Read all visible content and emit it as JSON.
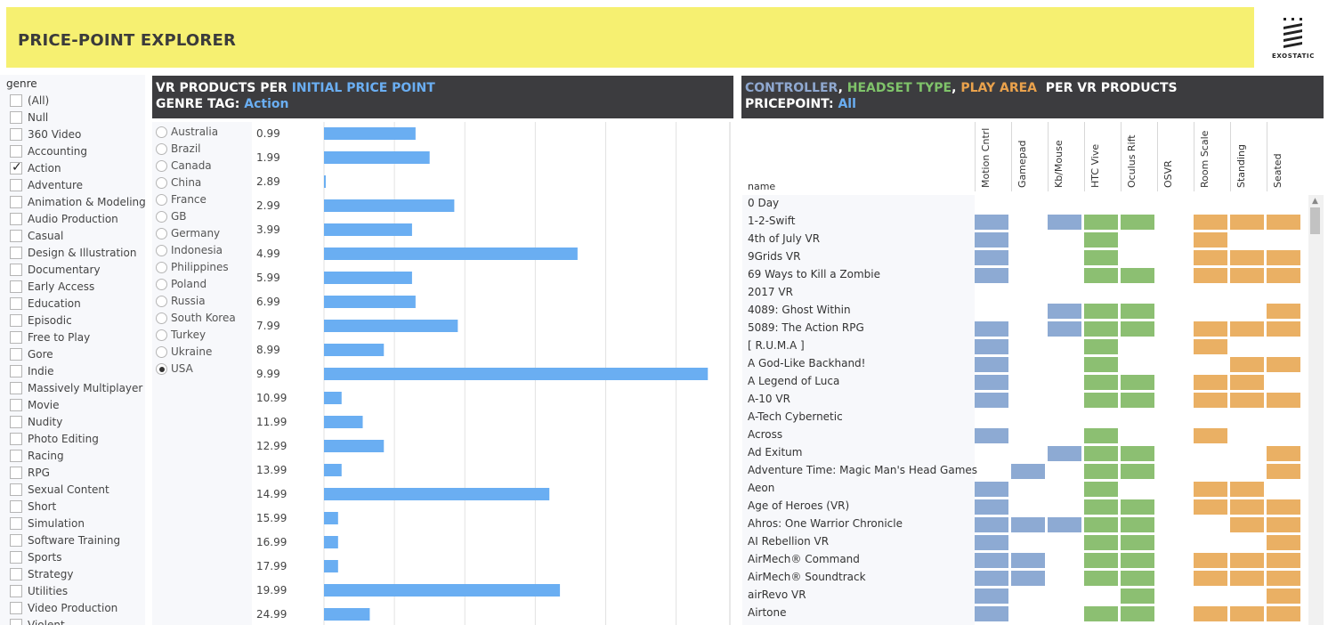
{
  "header": {
    "title": "PRICE-POINT EXPLORER",
    "logo_text": "EXOSTATIC"
  },
  "genre_filter": {
    "title": "genre",
    "items": [
      {
        "label": "(All)",
        "checked": false
      },
      {
        "label": "Null",
        "checked": false
      },
      {
        "label": "360 Video",
        "checked": false
      },
      {
        "label": "Accounting",
        "checked": false
      },
      {
        "label": "Action",
        "checked": true
      },
      {
        "label": "Adventure",
        "checked": false
      },
      {
        "label": "Animation & Modeling",
        "checked": false
      },
      {
        "label": "Audio Production",
        "checked": false
      },
      {
        "label": "Casual",
        "checked": false
      },
      {
        "label": "Design & Illustration",
        "checked": false
      },
      {
        "label": "Documentary",
        "checked": false
      },
      {
        "label": "Early Access",
        "checked": false
      },
      {
        "label": "Education",
        "checked": false
      },
      {
        "label": "Episodic",
        "checked": false
      },
      {
        "label": "Free to Play",
        "checked": false
      },
      {
        "label": "Gore",
        "checked": false
      },
      {
        "label": "Indie",
        "checked": false
      },
      {
        "label": "Massively Multiplayer",
        "checked": false
      },
      {
        "label": "Movie",
        "checked": false
      },
      {
        "label": "Nudity",
        "checked": false
      },
      {
        "label": "Photo Editing",
        "checked": false
      },
      {
        "label": "Racing",
        "checked": false
      },
      {
        "label": "RPG",
        "checked": false
      },
      {
        "label": "Sexual Content",
        "checked": false
      },
      {
        "label": "Short",
        "checked": false
      },
      {
        "label": "Simulation",
        "checked": false
      },
      {
        "label": "Software Training",
        "checked": false
      },
      {
        "label": "Sports",
        "checked": false
      },
      {
        "label": "Strategy",
        "checked": false
      },
      {
        "label": "Utilities",
        "checked": false
      },
      {
        "label": "Video Production",
        "checked": false
      },
      {
        "label": "Violent",
        "checked": false
      }
    ]
  },
  "left_chart": {
    "heading_line1_prefix": "VR PRODUCTS PER ",
    "heading_line1_highlight": "INITIAL PRICE POINT",
    "heading_line2_prefix": "GENRE TAG: ",
    "heading_line2_highlight": "Action"
  },
  "country_filter": {
    "items": [
      {
        "label": "Australia",
        "selected": false
      },
      {
        "label": "Brazil",
        "selected": false
      },
      {
        "label": "Canada",
        "selected": false
      },
      {
        "label": "China",
        "selected": false
      },
      {
        "label": "France",
        "selected": false
      },
      {
        "label": "GB",
        "selected": false
      },
      {
        "label": "Germany",
        "selected": false
      },
      {
        "label": "Indonesia",
        "selected": false
      },
      {
        "label": "Philippines",
        "selected": false
      },
      {
        "label": "Poland",
        "selected": false
      },
      {
        "label": "Russia",
        "selected": false
      },
      {
        "label": "South Korea",
        "selected": false
      },
      {
        "label": "Turkey",
        "selected": false
      },
      {
        "label": "Ukraine",
        "selected": false
      },
      {
        "label": "USA",
        "selected": true
      }
    ]
  },
  "chart_data": {
    "type": "bar",
    "orientation": "horizontal",
    "categories": [
      "0.99",
      "1.99",
      "2.89",
      "2.99",
      "3.99",
      "4.99",
      "5.99",
      "6.99",
      "7.99",
      "8.99",
      "9.99",
      "10.99",
      "11.99",
      "12.99",
      "13.99",
      "14.99",
      "15.99",
      "16.99",
      "17.99",
      "19.99",
      "24.99"
    ],
    "values": [
      26,
      30,
      0.5,
      37,
      25,
      72,
      25,
      26,
      38,
      17,
      109,
      5,
      11,
      17,
      5,
      64,
      4,
      4,
      4,
      67,
      13
    ],
    "xlim": [
      0,
      115
    ],
    "grid": true,
    "bar_color": "#6aaef2"
  },
  "right_matrix": {
    "heading_parts": [
      "CONTROLLER",
      ", ",
      "HEADSET TYPE",
      ", ",
      "PLAY AREA",
      "  PER VR PRODUCTS"
    ],
    "heading_line2_prefix": "PRICEPOINT: ",
    "heading_line2_highlight": "All",
    "name_header": "name",
    "columns": [
      {
        "label": "Motion Cntrl",
        "group": "controller"
      },
      {
        "label": "Gamepad",
        "group": "controller"
      },
      {
        "label": "Kb/Mouse",
        "group": "controller"
      },
      {
        "label": "HTC Vive",
        "group": "headset"
      },
      {
        "label": "Oculus Rift",
        "group": "headset"
      },
      {
        "label": "OSVR",
        "group": "headset"
      },
      {
        "label": "Room Scale",
        "group": "playarea"
      },
      {
        "label": "Standing",
        "group": "playarea"
      },
      {
        "label": "Seated",
        "group": "playarea"
      }
    ],
    "colors": {
      "controller": "#8daad3",
      "headset": "#8cbf72",
      "playarea": "#eab064"
    },
    "rows": [
      {
        "name": "0 Day",
        "cells": [
          0,
          0,
          0,
          0,
          0,
          0,
          0,
          0,
          0
        ]
      },
      {
        "name": "1-2-Swift",
        "cells": [
          1,
          0,
          1,
          1,
          1,
          0,
          1,
          1,
          1
        ]
      },
      {
        "name": "4th of July VR",
        "cells": [
          1,
          0,
          0,
          1,
          0,
          0,
          1,
          0,
          0
        ]
      },
      {
        "name": "9Grids VR",
        "cells": [
          1,
          0,
          0,
          1,
          0,
          0,
          1,
          1,
          1
        ]
      },
      {
        "name": "69 Ways to Kill a Zombie",
        "cells": [
          1,
          0,
          0,
          1,
          1,
          0,
          1,
          1,
          1
        ]
      },
      {
        "name": "2017 VR",
        "cells": [
          0,
          0,
          0,
          0,
          0,
          0,
          0,
          0,
          0
        ]
      },
      {
        "name": "4089: Ghost Within",
        "cells": [
          0,
          0,
          1,
          1,
          1,
          0,
          0,
          0,
          1
        ]
      },
      {
        "name": "5089: The Action RPG",
        "cells": [
          1,
          0,
          1,
          1,
          1,
          0,
          1,
          1,
          1
        ]
      },
      {
        "name": "[ R.U.M.A ]",
        "cells": [
          1,
          0,
          0,
          1,
          0,
          0,
          1,
          0,
          0
        ]
      },
      {
        "name": "A God-Like Backhand!",
        "cells": [
          1,
          0,
          0,
          1,
          0,
          0,
          0,
          1,
          1
        ]
      },
      {
        "name": "A Legend of Luca",
        "cells": [
          1,
          0,
          0,
          1,
          1,
          0,
          1,
          1,
          0
        ]
      },
      {
        "name": "A-10 VR",
        "cells": [
          1,
          0,
          0,
          1,
          1,
          0,
          1,
          1,
          1
        ]
      },
      {
        "name": "A-Tech Cybernetic",
        "cells": [
          0,
          0,
          0,
          0,
          0,
          0,
          0,
          0,
          0
        ]
      },
      {
        "name": "Across",
        "cells": [
          1,
          0,
          0,
          1,
          0,
          0,
          1,
          0,
          0
        ]
      },
      {
        "name": "Ad Exitum",
        "cells": [
          0,
          0,
          1,
          1,
          1,
          0,
          0,
          0,
          1
        ]
      },
      {
        "name": "Adventure Time: Magic Man's Head Games",
        "cells": [
          0,
          1,
          0,
          1,
          1,
          0,
          0,
          0,
          1
        ]
      },
      {
        "name": "Aeon",
        "cells": [
          1,
          0,
          0,
          1,
          0,
          0,
          1,
          1,
          0
        ]
      },
      {
        "name": "Age of Heroes (VR)",
        "cells": [
          1,
          0,
          0,
          1,
          1,
          0,
          1,
          1,
          1
        ]
      },
      {
        "name": "Ahros: One Warrior Chronicle",
        "cells": [
          1,
          1,
          1,
          1,
          1,
          0,
          0,
          1,
          1
        ]
      },
      {
        "name": "AI Rebellion VR",
        "cells": [
          1,
          0,
          0,
          1,
          1,
          0,
          0,
          0,
          1
        ]
      },
      {
        "name": "AirMech® Command",
        "cells": [
          1,
          1,
          0,
          1,
          1,
          0,
          1,
          1,
          1
        ]
      },
      {
        "name": "AirMech® Soundtrack",
        "cells": [
          1,
          1,
          0,
          1,
          1,
          0,
          1,
          1,
          1
        ]
      },
      {
        "name": "airRevo VR",
        "cells": [
          1,
          0,
          0,
          0,
          1,
          0,
          0,
          0,
          1
        ]
      },
      {
        "name": "Airtone",
        "cells": [
          1,
          0,
          0,
          1,
          1,
          0,
          1,
          1,
          1
        ]
      }
    ]
  }
}
